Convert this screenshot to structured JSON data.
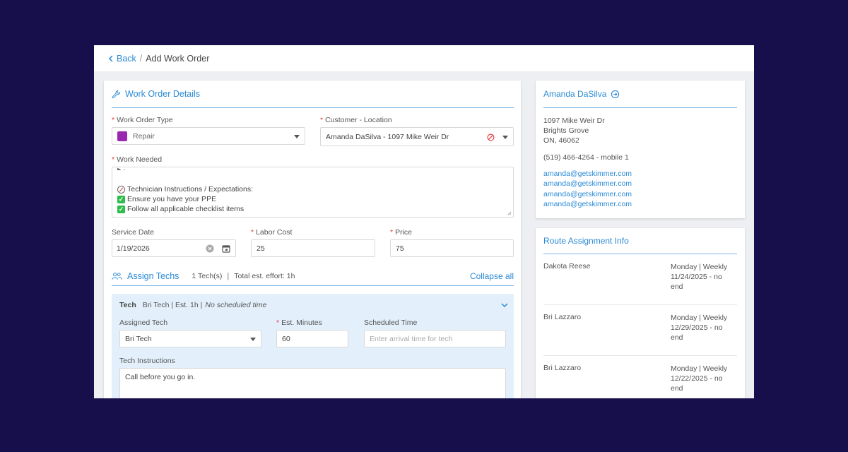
{
  "topbar": {
    "back_label": "Back",
    "separator": "/",
    "page_title": "Add Work Order"
  },
  "details": {
    "section_title": "Work Order Details",
    "work_order_type": {
      "label": "Work Order Type",
      "value": "Repair",
      "color": "#9b27b0"
    },
    "customer_location": {
      "label": "Customer - Location",
      "value": "Amanda DaSilva - 1097 Mike Weir Dr"
    },
    "work_needed": {
      "label": "Work Needed",
      "lines": [
        "Technician Instructions / Expectations:",
        "Ensure you have your PPE",
        "Follow all applicable checklist items"
      ]
    },
    "service_date": {
      "label": "Service Date",
      "value": "1/19/2026"
    },
    "labor_cost": {
      "label": "Labor Cost",
      "value": "25"
    },
    "price": {
      "label": "Price",
      "value": "75"
    }
  },
  "assign": {
    "title": "Assign Techs",
    "count": "1 Tech(s)",
    "separator": "|",
    "effort": "Total est. effort: 1h",
    "collapse_label": "Collapse all",
    "tech": {
      "header_label": "Tech",
      "summary": "Bri Tech | Est. 1h |",
      "summary_italic": "No scheduled time",
      "assigned_label": "Assigned Tech",
      "assigned_value": "Bri Tech",
      "minutes_label": "Est. Minutes",
      "minutes_value": "60",
      "scheduled_label": "Scheduled Time",
      "scheduled_placeholder": "Enter arrival time for tech",
      "instructions_label": "Tech Instructions",
      "instructions_value": "Call before you go in."
    }
  },
  "customer": {
    "name": "Amanda DaSilva",
    "address1": "1097 Mike Weir Dr",
    "address2": "Brights Grove",
    "address3": "ON, 46062",
    "phone": "(519) 466-4264 - mobile 1",
    "emails": [
      "amanda@getskimmer.com",
      "amanda@getskimmer.com",
      "amanda@getskimmer.com",
      "amanda@getskimmer.com"
    ]
  },
  "route": {
    "title": "Route Assignment Info",
    "rows": [
      {
        "tech": "Dakota Reese",
        "line1": "Monday | Weekly",
        "line2": "11/24/2025 - no",
        "line3": "end"
      },
      {
        "tech": "Bri Lazzaro",
        "line1": "Monday | Weekly",
        "line2": "12/29/2025 - no",
        "line3": "end"
      },
      {
        "tech": "Bri Lazzaro",
        "line1": "Monday | Weekly",
        "line2": "12/22/2025 - no",
        "line3": "end"
      }
    ]
  },
  "colors": {
    "accent": "#2a8ad6",
    "page_bg": "#160f4b",
    "required": "#e23c3c",
    "tech_panel": "#e3f0fb"
  }
}
